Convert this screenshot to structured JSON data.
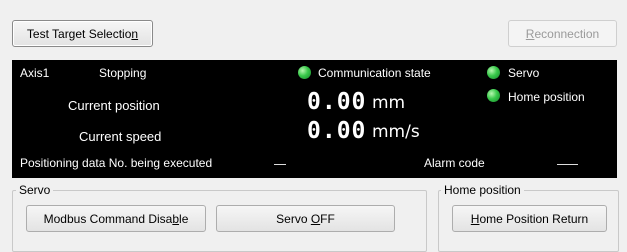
{
  "toolbar": {
    "test_target_label_pre": "Test Target Selectio",
    "test_target_label_u": "n",
    "reconnect_label_u": "R",
    "reconnect_label_post": "econnection"
  },
  "panel": {
    "axis": "Axis1",
    "status": "Stopping",
    "communication_state": "Communication state",
    "servo": "Servo",
    "home_position": "Home position",
    "current_position_label": "Current position",
    "current_position_value": "0.00",
    "current_position_unit": "mm",
    "current_speed_label": "Current speed",
    "current_speed_value": "0.00",
    "current_speed_unit": "mm/s",
    "positioning_label": "Positioning data No. being executed",
    "alarm_label": "Alarm code"
  },
  "servo_group": {
    "title": "Servo",
    "modbus_pre": "Modbus Command Disa",
    "modbus_u": "b",
    "modbus_post": "le",
    "servo_off_pre": "Servo ",
    "servo_off_u": "O",
    "servo_off_post": "FF"
  },
  "home_group": {
    "title": "Home position",
    "return_u": "H",
    "return_post": "ome Position Return"
  },
  "colors": {
    "led": "#38c94a",
    "panel_bg": "#000000"
  }
}
